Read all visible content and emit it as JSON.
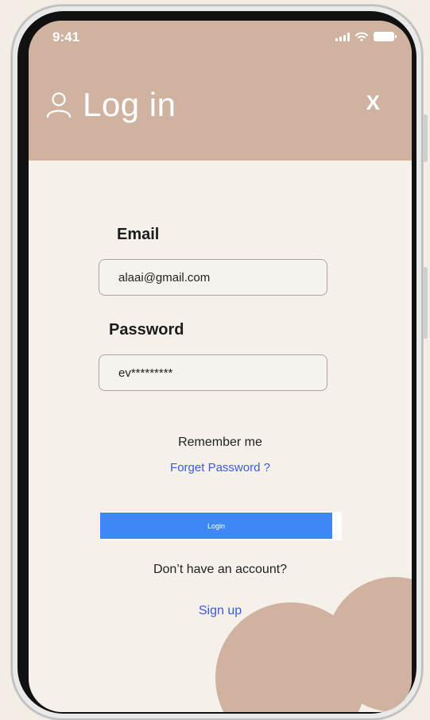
{
  "status_bar": {
    "time": "9:41"
  },
  "header": {
    "title": "Log in",
    "close_label": "X"
  },
  "form": {
    "email_label": "Email",
    "email_value": "alaai@gmail.com",
    "password_label": "Password",
    "password_value": "ev*********",
    "remember_label": "Remember me",
    "forgot_label": "Forget Password ?",
    "login_label": "Login"
  },
  "footer": {
    "no_account_text": "Don’t have an account?",
    "signup_label": "Sign up"
  },
  "colors": {
    "header_bg": "#cfb3a0",
    "screen_bg": "#f5f0ea",
    "button_bg": "#3f87f5",
    "link": "#3b5bdb"
  }
}
